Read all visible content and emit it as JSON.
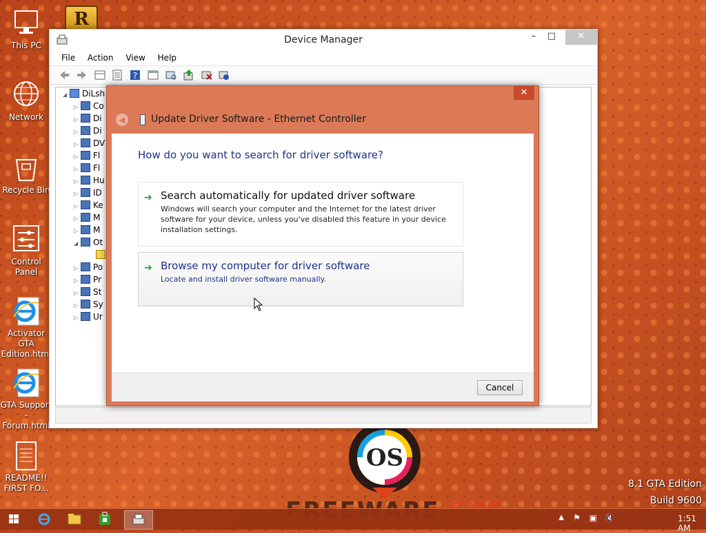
{
  "desktop": {
    "icons": [
      {
        "label": "This PC"
      },
      {
        "label": "Network"
      },
      {
        "label": "Recycle Bin"
      },
      {
        "label": "Control Panel"
      },
      {
        "label": "Activator GTA Edition.html"
      },
      {
        "label": "GTA Support - Forum.html"
      },
      {
        "label": "README!! FIRST FO..."
      }
    ],
    "edition_line1": "8.1 GTA Edition",
    "edition_line2": "Build 9600",
    "watermark_a": "FREEWARE",
    "watermark_b": "SYS"
  },
  "device_manager": {
    "title": "Device Manager",
    "menu": [
      "File",
      "Action",
      "View",
      "Help"
    ],
    "tree_root": "DiLsh",
    "tree_items": [
      "Co",
      "Di",
      "Di",
      "DV",
      "Fl",
      "Fl",
      "Hu",
      "ID",
      "Ke",
      "M",
      "M",
      "Ot",
      "",
      "Po",
      "Pr",
      "St",
      "Sy",
      "Ur"
    ]
  },
  "dialog": {
    "title": "Update Driver Software - Ethernet Controller",
    "question": "How do you want to search for driver software?",
    "option1_title": "Search automatically for updated driver software",
    "option1_desc": "Windows will search your computer and the Internet for the latest driver software for your device, unless you've disabled this feature in your device installation settings.",
    "option2_title": "Browse my computer for driver software",
    "option2_desc": "Locate and install driver software manually.",
    "cancel_label": "Cancel"
  },
  "taskbar": {
    "time": "1:51 AM"
  }
}
